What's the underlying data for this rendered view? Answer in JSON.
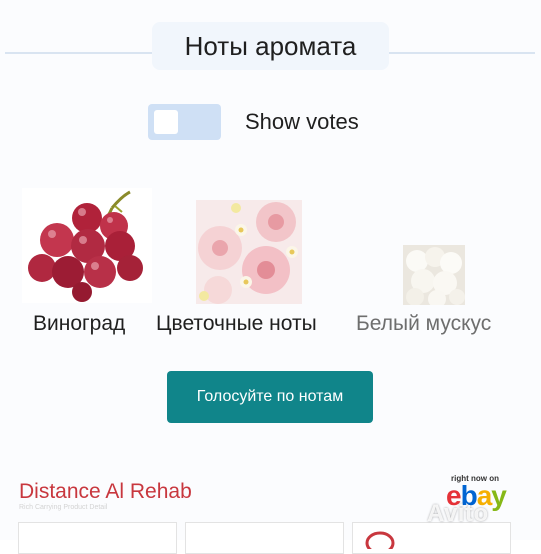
{
  "section": {
    "title": "Ноты аромата"
  },
  "toggle": {
    "label": "Show votes",
    "checked": false
  },
  "notes": [
    {
      "name": "Виноград",
      "image": "grapes"
    },
    {
      "name": "Цветочные ноты",
      "image": "flowers"
    },
    {
      "name": "Белый мускус",
      "image": "white-musk"
    }
  ],
  "vote_button": {
    "label": "Голосуйте по нотам"
  },
  "ad": {
    "title": "Distance Al Rehab",
    "faint_text": "Rich Carrying Product Detail",
    "ebay_caption": "right now on",
    "ebay_logo": [
      "e",
      "b",
      "a",
      "y"
    ]
  },
  "watermark": {
    "text": "Avito"
  },
  "colors": {
    "accent": "#10858a",
    "ad_title": "#c8373e",
    "toggle": "#cfe0f5"
  }
}
